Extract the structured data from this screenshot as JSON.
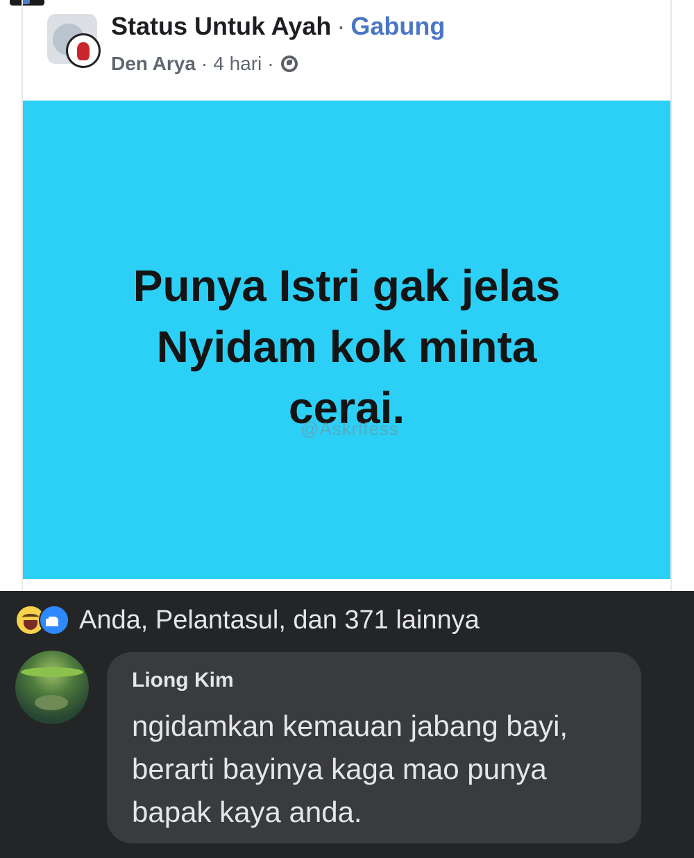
{
  "post": {
    "group_name": "Status Untuk Ayah",
    "separator": "·",
    "join_label": "Gabung",
    "author": "Den Arya",
    "meta_dot": "·",
    "time": "4 hari",
    "privacy_icon": "globe-icon",
    "status_text": "Punya Istri gak jelas\nNyidam kok minta\ncerai.",
    "watermark": "@Askrlfess",
    "background_color": "#2cd0f6"
  },
  "reactions": {
    "icons": [
      "haha-icon",
      "like-icon"
    ],
    "summary": "Anda, Pelantasul, dan 371 lainnya"
  },
  "comment": {
    "author": "Liong Kim",
    "text": "ngidamkan kemauan jabang bayi,\nberarti bayinya kaga mao punya\nbapak kaya anda."
  }
}
